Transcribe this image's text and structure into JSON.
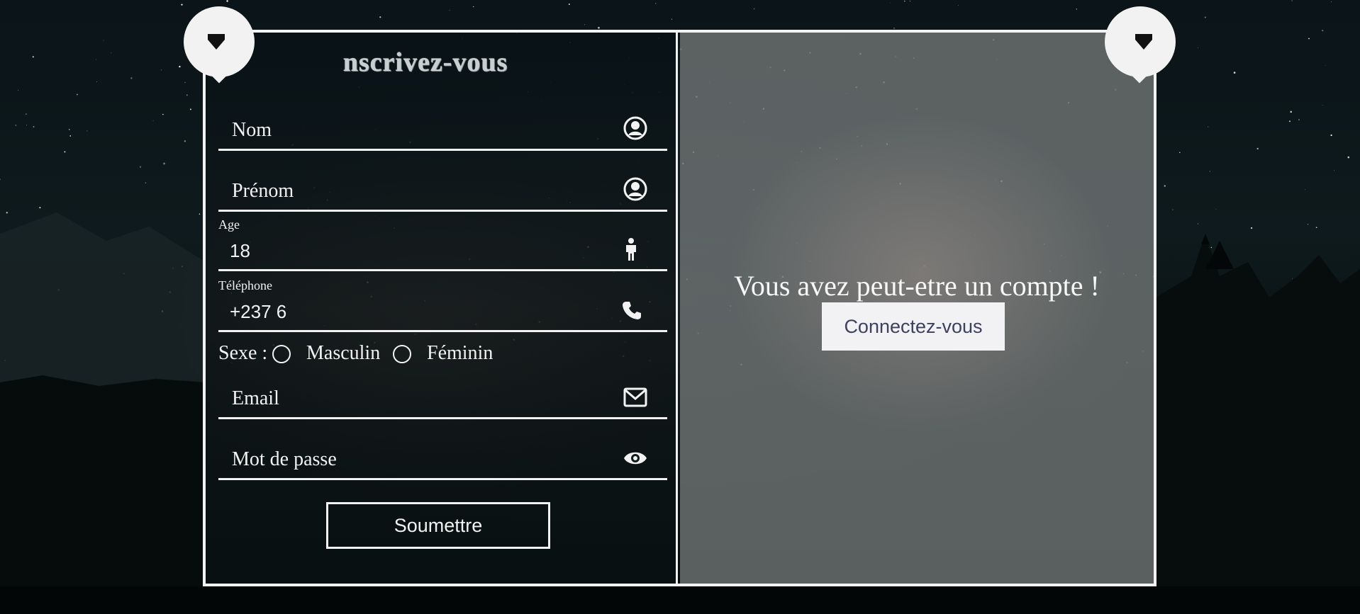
{
  "form": {
    "title": "nscrivez-vous",
    "fields": {
      "nom": {
        "placeholder": "Nom",
        "icon": "user-circle-icon"
      },
      "prenom": {
        "placeholder": "Prénom",
        "icon": "user-circle-icon"
      },
      "age": {
        "label": "Age",
        "value": "18",
        "icon": "person-icon"
      },
      "telephone": {
        "label": "Téléphone",
        "value": "+237 6",
        "icon": "phone-icon"
      },
      "email": {
        "placeholder": "Email",
        "icon": "envelope-icon"
      },
      "password": {
        "placeholder": "Mot de passe",
        "icon": "eye-icon"
      }
    },
    "sexe": {
      "label": "Sexe :",
      "options": [
        "Masculin",
        "Féminin"
      ]
    },
    "submit_label": "Soumettre"
  },
  "login_panel": {
    "prompt": "Vous avez peut-etre un compte !",
    "button_label": "Connectez-vous"
  },
  "decor": {
    "pins": [
      "pin-left-icon",
      "pin-right-icon"
    ],
    "background": "night-sky-mountains"
  },
  "colors": {
    "border": "#f2f2f2",
    "button_text": "#3f4060"
  }
}
